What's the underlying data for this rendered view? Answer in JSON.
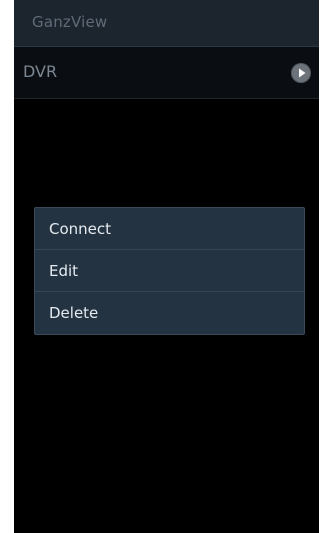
{
  "app": {
    "title": "GanzView"
  },
  "device_list": {
    "items": [
      {
        "name": "DVR",
        "action_icon": "play-circle-icon"
      }
    ]
  },
  "context_menu": {
    "items": [
      {
        "label": "Connect"
      },
      {
        "label": "Edit"
      },
      {
        "label": "Delete"
      }
    ]
  },
  "colors": {
    "background": "#000000",
    "title_bar": "#1c242d",
    "menu_background": "#243341",
    "menu_text": "#e6ebf0",
    "muted_text": "#5f6b78"
  }
}
